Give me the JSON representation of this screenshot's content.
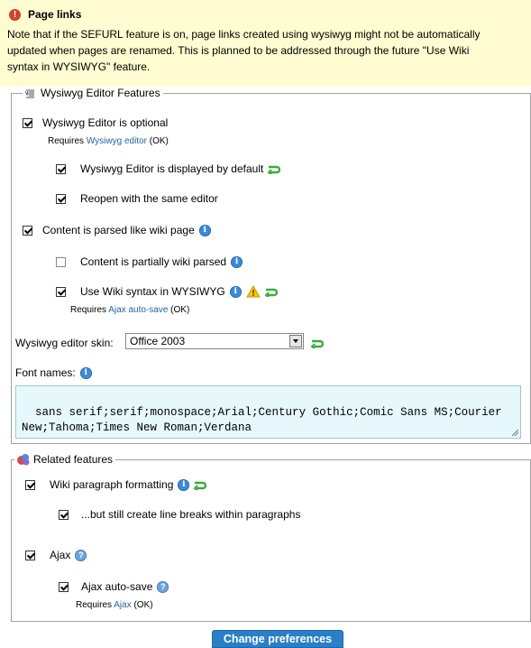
{
  "notice": {
    "title": "Page links",
    "line1": "Note that if the SEFURL feature is on, page links created using wysiwyg might not be automatically",
    "line2": "updated when pages are renamed. This is planned to be addressed through the future \"Use Wiki",
    "line3": "syntax in WYSIWYG\" feature."
  },
  "wysiwyg_section": {
    "legend": "Wysiwyg Editor Features",
    "items": [
      {
        "label": "Wysiwyg Editor is optional",
        "checked": true
      },
      {
        "label": "Wysiwyg Editor is displayed by default",
        "checked": true
      },
      {
        "label": "Reopen with the same editor",
        "checked": true
      },
      {
        "label": "Content is parsed like wiki page",
        "checked": true
      },
      {
        "label": "Content is partially wiki parsed",
        "checked": false
      },
      {
        "label": "Use Wiki syntax in WYSIWYG",
        "checked": true
      }
    ],
    "req1": {
      "prefix": "Requires ",
      "link": "Wysiwyg editor",
      "status": " (OK)"
    },
    "req2": {
      "prefix": "Requires ",
      "link": "Ajax auto-save",
      "status": " (OK)"
    },
    "skin_label": "Wysiwyg editor skin:",
    "skin_value": "Office 2003",
    "font_label": "Font names:",
    "font_value": "sans serif;serif;monospace;Arial;Century Gothic;Comic Sans MS;Courier New;Tahoma;Times New Roman;Verdana"
  },
  "related_section": {
    "legend": "Related features",
    "items": [
      {
        "label": "Wiki paragraph formatting",
        "checked": true
      },
      {
        "label": "...but still create line breaks within paragraphs",
        "checked": true
      },
      {
        "label": "Ajax",
        "checked": true
      },
      {
        "label": "Ajax auto-save",
        "checked": true
      }
    ],
    "req": {
      "prefix": "Requires ",
      "link": "Ajax",
      "status": " (OK)"
    }
  },
  "submit_label": "Change preferences",
  "colors": {
    "notice_bg": "#fefcd0",
    "link": "#2166a8",
    "button": "#2a7fc6",
    "textarea_bg": "#e6f8fc"
  },
  "icons": [
    "alert-icon",
    "editor-icon",
    "info-icon",
    "warning-icon",
    "refresh-icon",
    "related-icon",
    "help-icon"
  ]
}
